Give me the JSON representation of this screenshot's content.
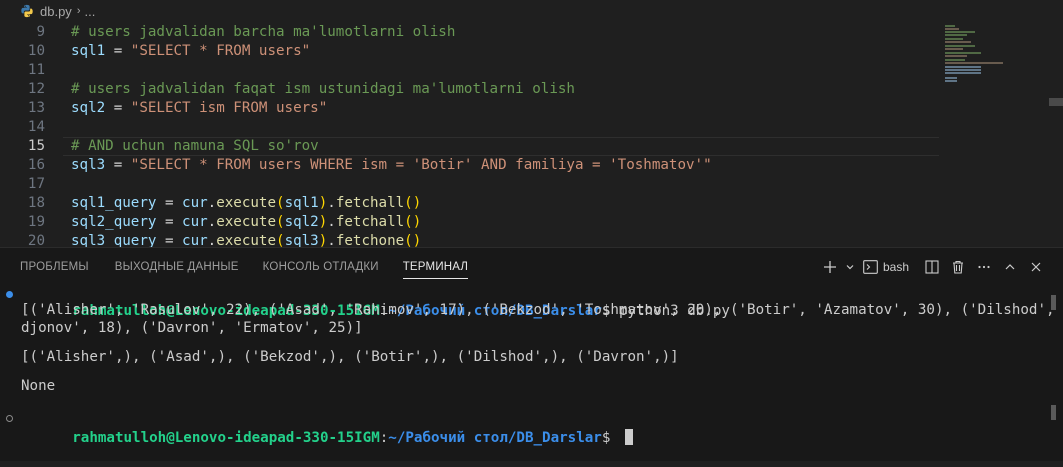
{
  "breadcrumb": {
    "file": "db.py",
    "more": "...",
    "separator": "›"
  },
  "editor": {
    "current_line": "15",
    "lines": [
      {
        "num": "9",
        "comment": "# users jadvalidan barcha ma'lumotlarni olish"
      },
      {
        "num": "10",
        "var": "sql1",
        "op": " = ",
        "str": "\"SELECT * FROM users\""
      },
      {
        "num": "11"
      },
      {
        "num": "12",
        "comment": "# users jadvalidan faqat ism ustunidagi ma'lumotlarni olish"
      },
      {
        "num": "13",
        "var": "sql2",
        "op": " = ",
        "str": "\"SELECT ism FROM users\""
      },
      {
        "num": "14"
      },
      {
        "num": "15",
        "comment": "# AND uchun namuna SQL so'rov"
      },
      {
        "num": "16",
        "var": "sql3",
        "op": " = ",
        "str": "\"SELECT * FROM users WHERE ism = 'Botir' AND familiya = 'Toshmatov'\""
      },
      {
        "num": "17"
      },
      {
        "num": "18",
        "var": "sql1_query",
        "op": " = ",
        "obj": "cur",
        "dot": ".",
        "fn": "execute",
        "p1": "(",
        "arg": "sql1",
        "p2": ")",
        "dot2": ".",
        "fn2": "fetchall",
        "p3": "()"
      },
      {
        "num": "19",
        "var": "sql2_query",
        "op": " = ",
        "obj": "cur",
        "dot": ".",
        "fn": "execute",
        "p1": "(",
        "arg": "sql2",
        "p2": ")",
        "dot2": ".",
        "fn2": "fetchall",
        "p3": "()"
      },
      {
        "num": "20",
        "var": "sql3_query",
        "op": " = ",
        "obj": "cur",
        "dot": ".",
        "fn": "execute",
        "p1": "(",
        "arg": "sql3",
        "p2": ")",
        "dot2": ".",
        "fn2": "fetchone",
        "p3": "()"
      }
    ]
  },
  "panel": {
    "tabs": [
      {
        "label": "ПРОБЛЕМЫ",
        "active": false
      },
      {
        "label": "ВЫХОДНЫЕ ДАННЫЕ",
        "active": false
      },
      {
        "label": "КОНСОЛЬ ОТЛАДКИ",
        "active": false
      },
      {
        "label": "ТЕРМИНАЛ",
        "active": true
      }
    ],
    "shell_label": "bash",
    "icons": [
      "add-terminal-icon",
      "chevron-down-icon",
      "bash-terminal-icon",
      "split-terminal-icon",
      "trash-icon",
      "more-icon",
      "maximize-panel-icon",
      "close-panel-icon"
    ]
  },
  "terminal": {
    "prompt_user": "rahmatulloh@Lenovo-ideapad-330-15IGM",
    "prompt_colon": ":",
    "prompt_path": "~/Рабочий стол/DB_Darslar",
    "prompt_dollar": "$ ",
    "command": "python3 db.py",
    "output1_line1": "[('Alisher', 'Rasulov', 22), ('Asad', 'Rahimov', 17), ('Bekzod', 'Toshmatov', 20), ('Botir', 'Azamatov', 30), ('Dilshod', 'Axma",
    "output1_line2": "djonov', 18), ('Davron', 'Ermatov', 25)]",
    "output2": "[('Alisher',), ('Asad',), ('Bekzod',), ('Botir',), ('Dilshod',), ('Davron',)]",
    "output3": "None"
  },
  "colors": {
    "prompt_user": "#23d18b",
    "prompt_path": "#3b8eea",
    "comment": "#6a9955",
    "string": "#ce9178",
    "variable": "#9cdcfe"
  }
}
